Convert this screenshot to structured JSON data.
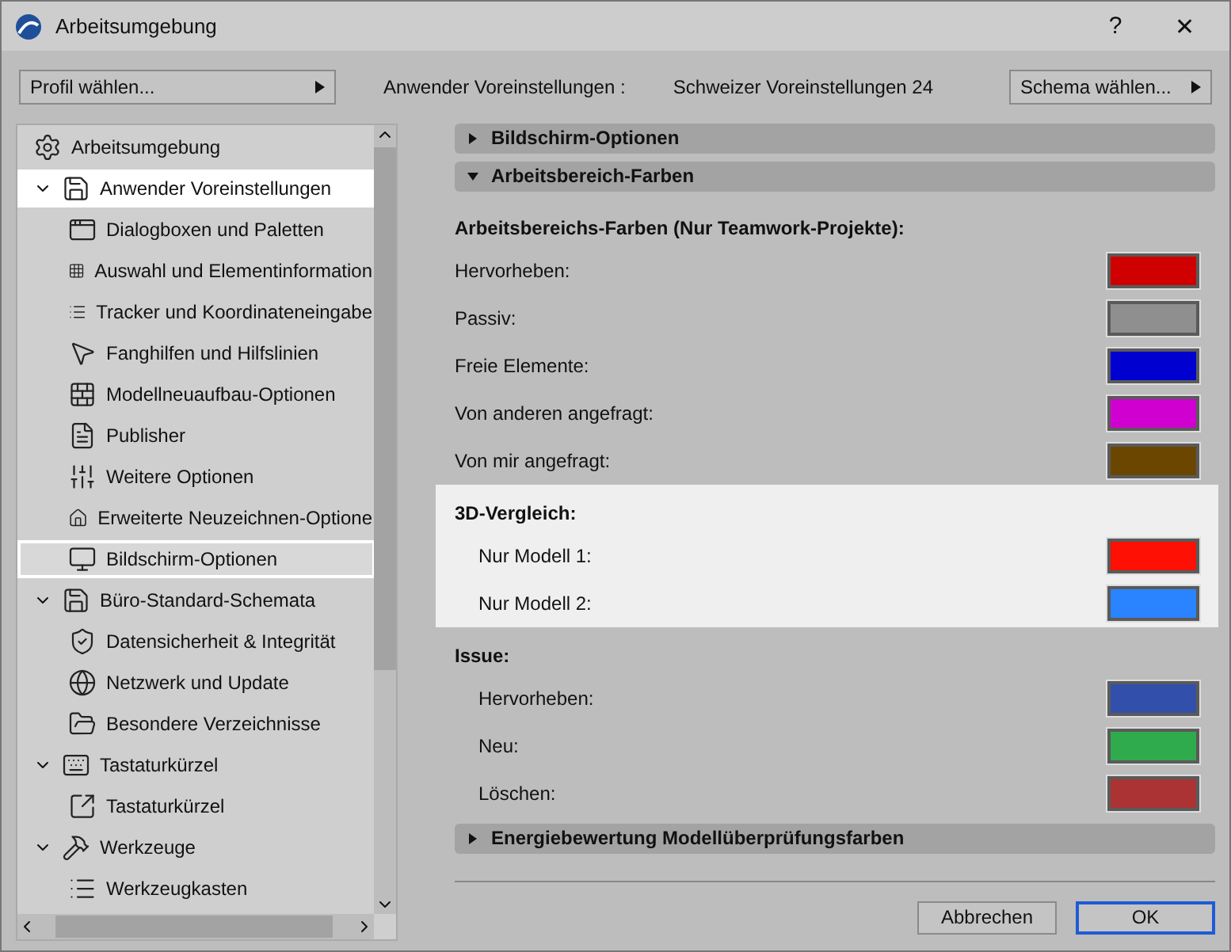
{
  "window": {
    "title": "Arbeitsumgebung",
    "help": "?",
    "close": "✕"
  },
  "toolbar": {
    "profile_button": "Profil wählen...",
    "info_label": "Anwender Voreinstellungen :",
    "info_value": "Schweizer Voreinstellungen 24",
    "schema_button": "Schema wählen..."
  },
  "tree": [
    {
      "label": "Arbeitsumgebung",
      "selected": false,
      "highlighted": false
    },
    {
      "label": "Anwender Voreinstellungen",
      "selected": false,
      "highlighted": true,
      "expanded": true,
      "children": [
        {
          "label": "Dialogboxen und Paletten",
          "selected": false,
          "highlighted": false
        },
        {
          "label": "Auswahl und Elementinformation",
          "selected": false,
          "highlighted": false
        },
        {
          "label": "Tracker und Koordinateneingabe",
          "selected": false,
          "highlighted": false
        },
        {
          "label": "Fanghilfen und Hilfslinien",
          "selected": false,
          "highlighted": false
        },
        {
          "label": "Modellneuaufbau-Optionen",
          "selected": false,
          "highlighted": false
        },
        {
          "label": "Publisher",
          "selected": false,
          "highlighted": false
        },
        {
          "label": "Weitere Optionen",
          "selected": false,
          "highlighted": false
        },
        {
          "label": "Erweiterte Neuzeichnen-Optione",
          "selected": false,
          "highlighted": false
        },
        {
          "label": "Bildschirm-Optionen",
          "selected": true,
          "highlighted": false
        }
      ]
    },
    {
      "label": "Büro-Standard-Schemata",
      "selected": false,
      "highlighted": false,
      "expanded": true,
      "children": [
        {
          "label": "Datensicherheit & Integrität",
          "selected": false,
          "highlighted": false
        },
        {
          "label": "Netzwerk und Update",
          "selected": false,
          "highlighted": false
        },
        {
          "label": "Besondere Verzeichnisse",
          "selected": false,
          "highlighted": false
        }
      ]
    },
    {
      "label": "Tastaturkürzel",
      "selected": false,
      "highlighted": false,
      "expanded": true,
      "children": [
        {
          "label": "Tastaturkürzel",
          "selected": false,
          "highlighted": false
        }
      ]
    },
    {
      "label": "Werkzeuge",
      "selected": false,
      "highlighted": false,
      "expanded": true,
      "children": [
        {
          "label": "Werkzeugkasten",
          "selected": false,
          "highlighted": false
        }
      ]
    }
  ],
  "sections": [
    {
      "title": "Bildschirm-Optionen",
      "expanded": false
    },
    {
      "title": "Arbeitsbereich-Farben",
      "expanded": true,
      "groups": [
        {
          "title": "Arbeitsbereichs-Farben (Nur Teamwork-Projekte):",
          "kind": "flat",
          "highlighted": false,
          "rows": [
            {
              "label": "Hervorheben:",
              "color": "#d00000"
            },
            {
              "label": "Passiv:",
              "color": "#8f8f8f"
            },
            {
              "label": "Freie Elemente:",
              "color": "#0000d0"
            },
            {
              "label": "Von anderen angefragt:",
              "color": "#d000d0"
            },
            {
              "label": "Von mir angefragt:",
              "color": "#6b4600"
            }
          ]
        },
        {
          "title": "3D-Vergleich:",
          "kind": "indented",
          "highlighted": true,
          "rows": [
            {
              "label": "Nur Modell 1:",
              "color": "#ff1005"
            },
            {
              "label": "Nur Modell 2:",
              "color": "#2a84ff"
            }
          ]
        },
        {
          "title": "Issue:",
          "kind": "indented",
          "highlighted": false,
          "rows": [
            {
              "label": "Hervorheben:",
              "color": "#3250ab"
            },
            {
              "label": "Neu:",
              "color": "#2fab4d"
            },
            {
              "label": "Löschen:",
              "color": "#ac3333"
            }
          ]
        }
      ]
    },
    {
      "title": "Energiebewertung Modellüberprüfungsfarben",
      "expanded": false
    }
  ],
  "buttons": [
    {
      "label": "Abbrechen",
      "default": false
    },
    {
      "label": "OK",
      "default": true
    }
  ]
}
